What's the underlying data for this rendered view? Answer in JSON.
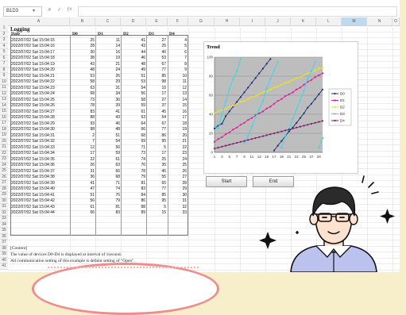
{
  "formula_bar": {
    "name_box": "B1D3"
  },
  "columns": [
    "A",
    "B",
    "C",
    "D",
    "E",
    "F",
    "G",
    "H",
    "I",
    "J",
    "K",
    "L",
    "M",
    "N",
    "O"
  ],
  "selected_column": "M",
  "sheet": {
    "title": "Logging",
    "headers": [
      "Date",
      "D0",
      "D1",
      "D2",
      "D3",
      "D4"
    ],
    "rows": [
      [
        "2022/07/02 Sat 15:04:15",
        "25",
        "11",
        "41",
        "27",
        "4"
      ],
      [
        "2022/07/02 Sat 15:04:16",
        "28",
        "14",
        "43",
        "25",
        "5"
      ],
      [
        "2022/07/02 Sat 15:04:17",
        "30",
        "16",
        "44",
        "40",
        "6"
      ],
      [
        "2022/07/02 Sat 15:04:18",
        "38",
        "19",
        "46",
        "53",
        "7"
      ],
      [
        "2022/07/02 Sat 15:04:19",
        "43",
        "21",
        "48",
        "67",
        "8"
      ],
      [
        "2022/07/02 Sat 15:04:20",
        "48",
        "24",
        "49",
        "77",
        "9"
      ],
      [
        "2022/07/02 Sat 15:04:21",
        "53",
        "26",
        "51",
        "85",
        "10"
      ],
      [
        "2022/07/02 Sat 15:04:22",
        "58",
        "29",
        "53",
        "98",
        "11"
      ],
      [
        "2022/07/02 Sat 15:04:23",
        "63",
        "31",
        "54",
        "10",
        "12"
      ],
      [
        "2022/07/02 Sat 15:04:24",
        "68",
        "34",
        "56",
        "17",
        "13"
      ],
      [
        "2022/07/02 Sat 15:04:25",
        "73",
        "36",
        "58",
        "27",
        "14"
      ],
      [
        "2022/07/02 Sat 15:04:26",
        "78",
        "39",
        "59",
        "37",
        "15"
      ],
      [
        "2022/07/02 Sat 15:04:27",
        "83",
        "41",
        "61",
        "45",
        "16"
      ],
      [
        "2022/07/02 Sat 15:04:28",
        "88",
        "43",
        "63",
        "54",
        "17"
      ],
      [
        "2022/07/02 Sat 15:04:29",
        "93",
        "46",
        "64",
        "67",
        "18"
      ],
      [
        "2022/07/02 Sat 15:04:30",
        "98",
        "48",
        "66",
        "77",
        "19"
      ],
      [
        "2022/07/02 Sat 15:04:31",
        "2",
        "51",
        "68",
        "86",
        "20"
      ],
      [
        "2022/07/02 Sat 15:04:32",
        "7",
        "54",
        "69",
        "95",
        "21"
      ],
      [
        "2022/07/02 Sat 15:04:33",
        "12",
        "56",
        "71",
        "5",
        "22"
      ],
      [
        "2022/07/02 Sat 15:04:34",
        "17",
        "59",
        "73",
        "17",
        "23"
      ],
      [
        "2022/07/02 Sat 15:04:35",
        "22",
        "61",
        "74",
        "25",
        "24"
      ],
      [
        "2022/07/02 Sat 15:04:36",
        "26",
        "63",
        "76",
        "35",
        "25"
      ],
      [
        "2022/07/02 Sat 15:04:37",
        "31",
        "66",
        "78",
        "45",
        "26"
      ],
      [
        "2022/07/02 Sat 15:04:38",
        "36",
        "68",
        "79",
        "55",
        "27"
      ],
      [
        "2022/07/02 Sat 15:04:39",
        "41",
        "71",
        "81",
        "65",
        "28"
      ],
      [
        "2022/07/02 Sat 15:04:40",
        "47",
        "74",
        "83",
        "77",
        "29"
      ],
      [
        "2022/07/02 Sat 15:04:41",
        "51",
        "76",
        "84",
        "85",
        "30"
      ],
      [
        "2022/07/02 Sat 15:04:42",
        "56",
        "79",
        "86",
        "95",
        "31"
      ],
      [
        "2022/07/02 Sat 15:04:43",
        "61",
        "81",
        "88",
        "5",
        "32"
      ],
      [
        "2022/07/02 Sat 15:04:44",
        "66",
        "83",
        "89",
        "15",
        "33"
      ]
    ],
    "comment_label": "[Content]",
    "note_1": "The value of devices D0-D4 is displayed at interval of 1second.",
    "note_2": "All communication setting of this example is defalut setting of \"Open\"."
  },
  "chart_data": {
    "type": "line",
    "title": "Trend",
    "x": [
      1,
      2,
      3,
      4,
      5,
      6,
      7,
      8,
      9,
      10,
      11,
      12,
      13,
      14,
      15,
      16,
      17,
      18,
      19,
      20,
      21,
      22,
      23,
      24,
      25,
      26,
      27,
      28,
      29,
      30
    ],
    "x_tick_labels": [
      "1",
      "3",
      "5",
      "7",
      "9",
      "11",
      "13",
      "15",
      "17",
      "19",
      "21",
      "23",
      "25",
      "27",
      "29"
    ],
    "ylim": [
      0,
      100
    ],
    "y_ticks": [
      0,
      20,
      40,
      60,
      80,
      100
    ],
    "grid": true,
    "legend_position": "right",
    "series": [
      {
        "name": "D0",
        "color": "#1f2b7a",
        "values": [
          25,
          28,
          30,
          38,
          43,
          48,
          53,
          58,
          63,
          68,
          73,
          78,
          83,
          88,
          93,
          98,
          2,
          7,
          12,
          17,
          22,
          26,
          31,
          36,
          41,
          47,
          51,
          56,
          61,
          66
        ]
      },
      {
        "name": "D1",
        "color": "#e0149a",
        "values": [
          11,
          14,
          16,
          19,
          21,
          24,
          26,
          29,
          31,
          34,
          36,
          39,
          41,
          43,
          46,
          48,
          51,
          54,
          56,
          59,
          61,
          63,
          66,
          68,
          71,
          74,
          76,
          79,
          81,
          83
        ]
      },
      {
        "name": "D2",
        "color": "#f2e800",
        "values": [
          41,
          43,
          44,
          46,
          48,
          49,
          51,
          53,
          54,
          56,
          58,
          59,
          61,
          63,
          64,
          66,
          68,
          69,
          71,
          73,
          74,
          76,
          78,
          79,
          81,
          83,
          84,
          86,
          88,
          89
        ]
      },
      {
        "name": "D3",
        "color": "#33d9e8",
        "values": [
          27,
          25,
          40,
          53,
          67,
          77,
          85,
          98,
          10,
          17,
          27,
          37,
          45,
          54,
          67,
          77,
          86,
          95,
          5,
          17,
          25,
          35,
          45,
          55,
          65,
          77,
          85,
          95,
          5,
          15
        ]
      },
      {
        "name": "D4",
        "color": "#7a1f6e",
        "values": [
          4,
          5,
          6,
          7,
          8,
          9,
          10,
          11,
          12,
          13,
          14,
          15,
          16,
          17,
          18,
          19,
          20,
          21,
          22,
          23,
          24,
          25,
          26,
          27,
          28,
          29,
          30,
          31,
          32,
          33
        ]
      }
    ]
  },
  "buttons": {
    "start": "Start",
    "end": "End"
  },
  "colors": {
    "selected_column": "#bfd9f0",
    "plot_bg": "#bdbdbd",
    "background": "#f7efc9",
    "arc": "#ef8d8d"
  },
  "icons": [
    "close-icon",
    "check-icon",
    "fx-icon",
    "sparkle-icon",
    "person-illustration"
  ]
}
